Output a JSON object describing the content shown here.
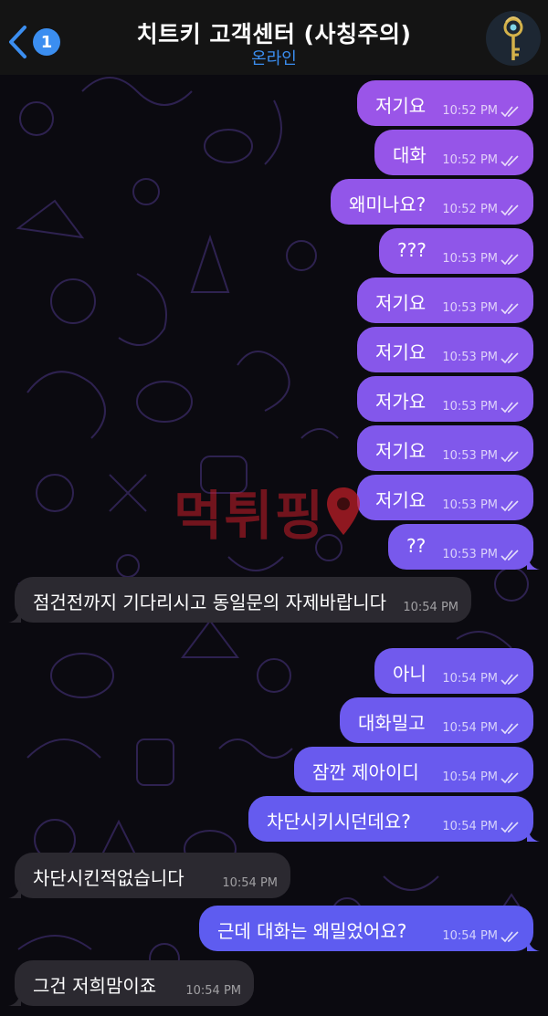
{
  "header": {
    "back_badge": "1",
    "title": "치트키 고객센터 (사칭주의)",
    "status": "온라인",
    "status_color": "#3b8ef0",
    "avatar_icon": "key-icon"
  },
  "messages": [
    {
      "direction": "out",
      "text": "저기요",
      "time": "10:52 PM",
      "read": true
    },
    {
      "direction": "out",
      "text": "대화",
      "time": "10:52 PM",
      "read": true
    },
    {
      "direction": "out",
      "text": "왜미나요?",
      "time": "10:52 PM",
      "read": true
    },
    {
      "direction": "out",
      "text": "???",
      "time": "10:53 PM",
      "read": true
    },
    {
      "direction": "out",
      "text": "저기요",
      "time": "10:53 PM",
      "read": true
    },
    {
      "direction": "out",
      "text": "저기요",
      "time": "10:53 PM",
      "read": true
    },
    {
      "direction": "out",
      "text": "저가요",
      "time": "10:53 PM",
      "read": true
    },
    {
      "direction": "out",
      "text": "저기요",
      "time": "10:53 PM",
      "read": true
    },
    {
      "direction": "out",
      "text": "저기요",
      "time": "10:53 PM",
      "read": true
    },
    {
      "direction": "out",
      "text": "??",
      "time": "10:53 PM",
      "read": true
    },
    {
      "direction": "in",
      "text": "점건전까지 기다리시고 동일문의 자제바랍니다",
      "time": "10:54 PM"
    },
    {
      "direction": "out",
      "text": "아니",
      "time": "10:54 PM",
      "read": true
    },
    {
      "direction": "out",
      "text": "대화밀고",
      "time": "10:54 PM",
      "read": true
    },
    {
      "direction": "out",
      "text": "잠깐 제아이디",
      "time": "10:54 PM",
      "read": true
    },
    {
      "direction": "out",
      "text": "차단시키시던데요?",
      "time": "10:54 PM",
      "read": true
    },
    {
      "direction": "in",
      "text": "차단시킨적없습니다",
      "time": "10:54 PM"
    },
    {
      "direction": "out",
      "text": "근데 대화는 왜밀었어요?",
      "time": "10:54 PM",
      "read": true
    },
    {
      "direction": "in",
      "text": "그건 저희맘이죠",
      "time": "10:54 PM"
    }
  ],
  "watermark": "먹튀핑",
  "colors": {
    "header_bg": "#141414",
    "incoming_bubble": "#2b2930",
    "outgoing_top": "#9a55e8",
    "outgoing_bottom": "#5a5cf0",
    "accent": "#3b8ef0",
    "watermark": "#c81e28"
  }
}
